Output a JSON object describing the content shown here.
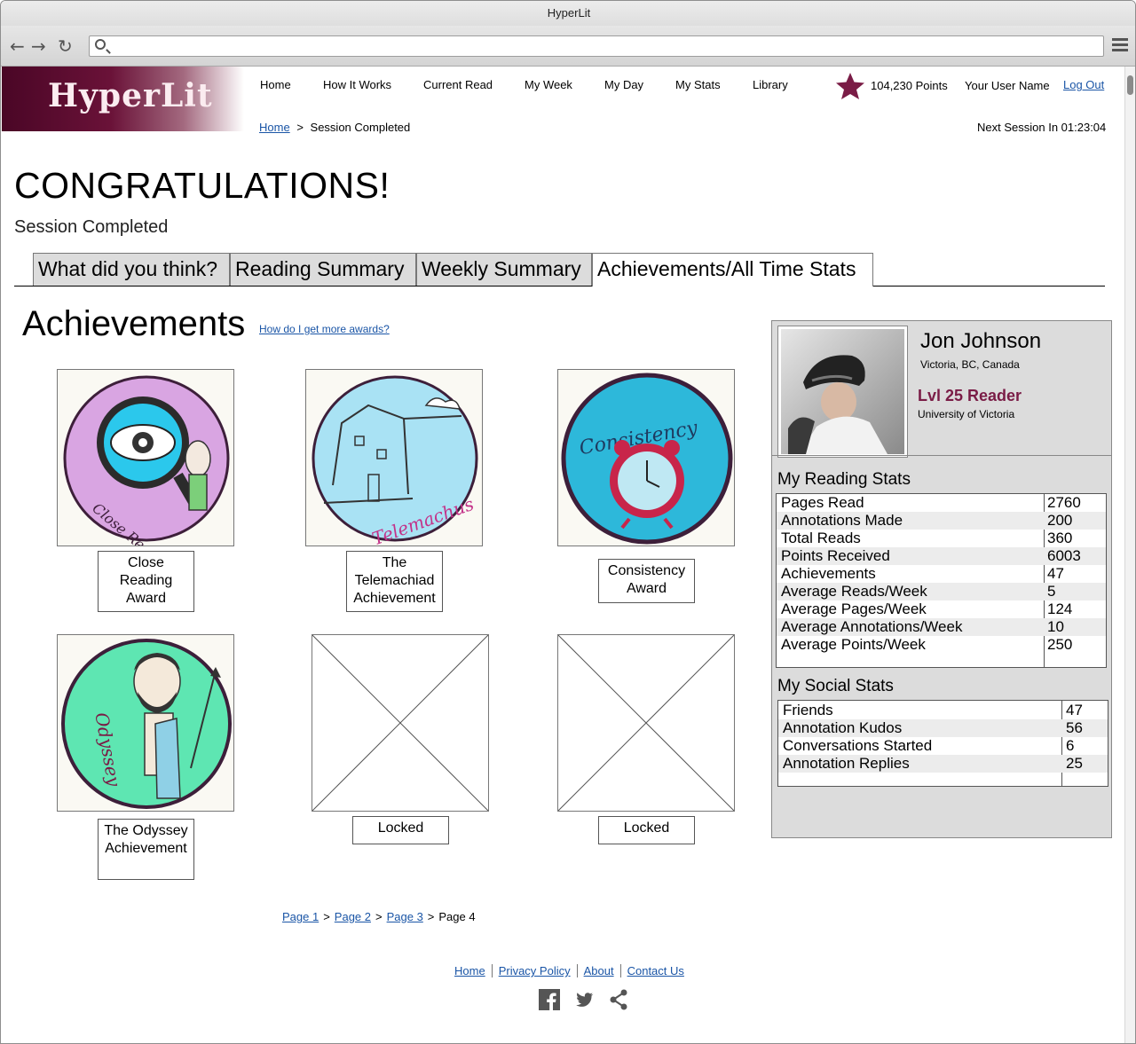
{
  "browser": {
    "title": "HyperLit",
    "url": ""
  },
  "header": {
    "logo": "HyperLit",
    "nav": [
      "Home",
      "How It Works",
      "Current Read",
      "My Week",
      "My Day",
      "My Stats",
      "Library"
    ],
    "points": "104,230 Points",
    "username": "Your User Name",
    "logout": "Log Out",
    "breadcrumb": {
      "home": "Home",
      "separator": ">",
      "current": "Session Completed"
    },
    "next_session": "Next Session In 01:23:04"
  },
  "page": {
    "headline": "CONGRATULATIONS!",
    "subtitle": "Session Completed"
  },
  "tabs": [
    {
      "label": "What did you think?",
      "active": false
    },
    {
      "label": "Reading Summary",
      "active": false
    },
    {
      "label": "Weekly Summary",
      "active": false
    },
    {
      "label": "Achievements/All Time Stats",
      "active": true
    }
  ],
  "achievements": {
    "title": "Achievements",
    "help_link": "How do I get more awards?",
    "awards": [
      {
        "label": "Close Reading Award",
        "lines": [
          "Close",
          "Reading",
          "Award"
        ],
        "art_text": "Close Reading!",
        "icon": "magnifier-eye-icon",
        "color": "#d9a5e2"
      },
      {
        "label": "The Telemachiad Achievement",
        "lines": [
          "The",
          "Telemachiad",
          "Achievement"
        ],
        "art_text": "Telemachus",
        "icon": "house-icon",
        "color": "#a9e2f4"
      },
      {
        "label": "Consistency Award",
        "lines": [
          "Consistency",
          "Award"
        ],
        "art_text": "Consistency",
        "icon": "alarm-clock-icon",
        "color": "#2db8da"
      },
      {
        "label": "The Odyssey Achievement",
        "lines": [
          "The Odyssey",
          "Achievement"
        ],
        "art_text": "Odyssey",
        "icon": "bearded-man-icon",
        "color": "#5ee6b2"
      },
      {
        "label": "Locked",
        "lines": [
          "Locked"
        ],
        "icon": "locked-placeholder-icon"
      },
      {
        "label": "Locked",
        "lines": [
          "Locked"
        ],
        "icon": "locked-placeholder-icon"
      }
    ],
    "pager": {
      "pages": [
        "Page 1",
        "Page 2",
        "Page 3"
      ],
      "current": "Page 4",
      "separator": ">"
    }
  },
  "profile": {
    "name": "Jon Johnson",
    "location": "Victoria, BC, Canada",
    "level": "Lvl 25 Reader",
    "university": "University of Victoria",
    "reading_stats_title": "My Reading Stats",
    "reading_stats": [
      {
        "label": "Pages Read",
        "value": "2760"
      },
      {
        "label": "Annotations Made",
        "value": "200"
      },
      {
        "label": "Total Reads",
        "value": "360"
      },
      {
        "label": "Points Received",
        "value": "6003"
      },
      {
        "label": "Achievements",
        "value": "47"
      },
      {
        "label": "Average Reads/Week",
        "value": "5"
      },
      {
        "label": "Average Pages/Week",
        "value": "124"
      },
      {
        "label": "Average Annotations/Week",
        "value": "10"
      },
      {
        "label": "Average Points/Week",
        "value": "250"
      }
    ],
    "social_stats_title": "My Social Stats",
    "social_stats": [
      {
        "label": "Friends",
        "value": "47"
      },
      {
        "label": "Annotation Kudos",
        "value": "56"
      },
      {
        "label": "Conversations Started",
        "value": "6"
      },
      {
        "label": "Annotation Replies",
        "value": "25"
      }
    ]
  },
  "footer": {
    "links": [
      "Home",
      "Privacy Policy",
      "About",
      "Contact Us"
    ],
    "social_icons": [
      "facebook-icon",
      "twitter-icon",
      "share-icon"
    ]
  },
  "colors": {
    "brand": "#6a1238",
    "link": "#1a55a6",
    "star": "#7a1c46",
    "level": "#7a1c46"
  }
}
